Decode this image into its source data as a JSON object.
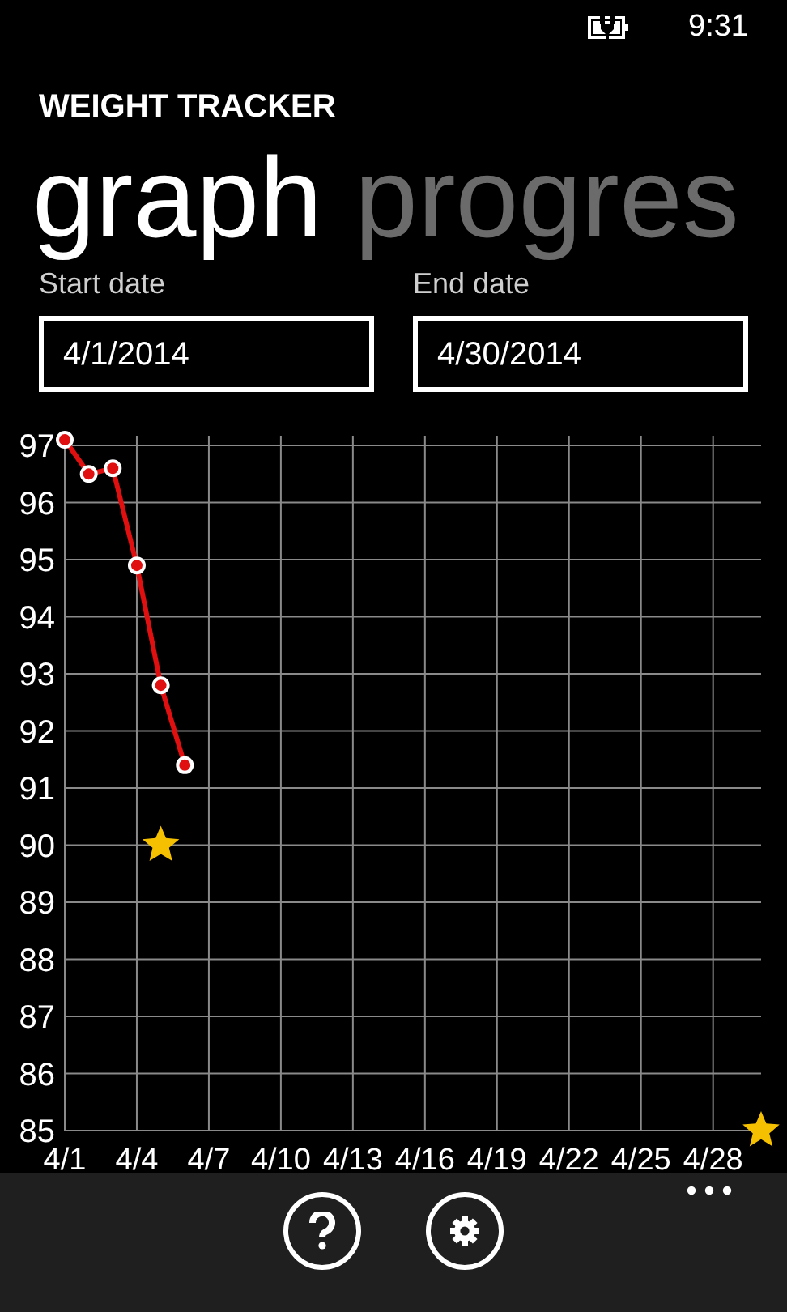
{
  "status_bar": {
    "time": "9:31"
  },
  "app_title": "WEIGHT TRACKER",
  "pivot": [
    {
      "label": "graph",
      "selected": true
    },
    {
      "label": "progres",
      "selected": false
    }
  ],
  "fields": [
    {
      "label": "Start date",
      "value": "4/1/2014"
    },
    {
      "label": "End date",
      "value": "4/30/2014"
    }
  ],
  "chart_data": {
    "type": "line",
    "categories": [
      "4/1",
      null,
      null,
      "4/4",
      null,
      null,
      "4/7",
      null,
      null,
      "4/10",
      null,
      null,
      "4/13",
      null,
      null,
      "4/16",
      null,
      null,
      "4/19",
      null,
      null,
      "4/22",
      null,
      null,
      "4/25",
      null,
      null,
      "4/28",
      null,
      null
    ],
    "grid": true,
    "series": [
      {
        "color": "#e01010",
        "marker": true,
        "values": [
          97.1,
          96.5,
          96.6,
          94.9,
          92.8,
          91.4,
          null,
          null,
          null,
          null,
          null,
          null,
          null,
          null,
          null,
          null,
          null,
          null,
          null,
          null,
          null,
          null,
          null,
          null,
          null,
          null,
          null,
          null,
          null,
          null
        ]
      },
      {
        "type": "scatter",
        "color": "#f5c000",
        "values": [
          null,
          null,
          null,
          null,
          90,
          null,
          null,
          null,
          null,
          null,
          null,
          null,
          null,
          null,
          null,
          null,
          null,
          null,
          null,
          null,
          null,
          null,
          null,
          null,
          null,
          null,
          null,
          null,
          null,
          85
        ]
      }
    ],
    "ylim": [
      85,
      97.2
    ],
    "yticks": [
      85,
      86,
      87,
      88,
      89,
      90,
      91,
      92,
      93,
      94,
      95,
      96,
      97
    ]
  },
  "app_bar": {
    "buttons": [
      {
        "kind": "help"
      },
      {
        "kind": "settings"
      }
    ]
  }
}
